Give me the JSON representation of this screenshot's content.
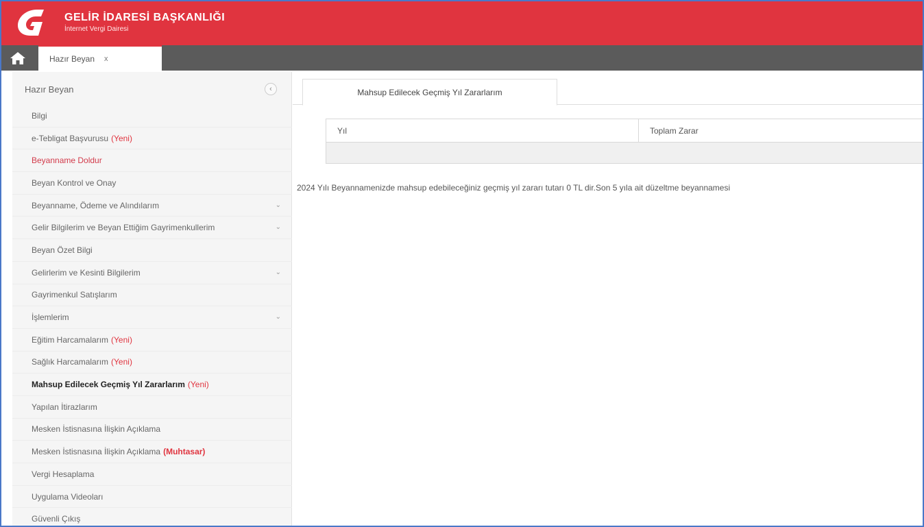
{
  "header": {
    "title": "GELİR İDARESİ BAŞKANLIĞI",
    "subtitle": "İnternet Vergi Dairesi",
    "bg_color": "#e0343f"
  },
  "tabbar": {
    "home_icon": "home-icon",
    "tabs": [
      {
        "label": "Hazır Beyan",
        "close": "x"
      }
    ]
  },
  "sidebar": {
    "title": "Hazır Beyan",
    "collapse_symbol": "‹",
    "items": [
      {
        "label": "Bilgi",
        "badge": "",
        "style": "normal",
        "chevron": ""
      },
      {
        "label": "e-Tebligat Başvurusu",
        "badge": "(Yeni)",
        "style": "normal",
        "chevron": ""
      },
      {
        "label": "Beyanname Doldur",
        "badge": "",
        "style": "red",
        "chevron": ""
      },
      {
        "label": "Beyan Kontrol ve Onay",
        "badge": "",
        "style": "normal",
        "chevron": ""
      },
      {
        "label": "Beyanname, Ödeme ve Alındılarım",
        "badge": "",
        "style": "normal",
        "chevron": "⌄"
      },
      {
        "label": "Gelir Bilgilerim ve Beyan Ettiğim Gayrimenkullerim",
        "badge": "",
        "style": "normal",
        "chevron": "⌄"
      },
      {
        "label": "Beyan Özet Bilgi",
        "badge": "",
        "style": "normal",
        "chevron": ""
      },
      {
        "label": "Gelirlerim ve Kesinti Bilgilerim",
        "badge": "",
        "style": "normal",
        "chevron": "⌄"
      },
      {
        "label": "Gayrimenkul Satışlarım",
        "badge": "",
        "style": "normal",
        "chevron": ""
      },
      {
        "label": "İşlemlerim",
        "badge": "",
        "style": "normal",
        "chevron": "⌄"
      },
      {
        "label": "Eğitim Harcamalarım",
        "badge": "(Yeni)",
        "style": "normal",
        "chevron": ""
      },
      {
        "label": "Sağlık Harcamalarım",
        "badge": "(Yeni)",
        "style": "normal",
        "chevron": ""
      },
      {
        "label": "Mahsup Edilecek Geçmiş Yıl Zararlarım",
        "badge": "(Yeni)",
        "style": "active",
        "chevron": ""
      },
      {
        "label": "Yapılan İtirazlarım",
        "badge": "",
        "style": "normal",
        "chevron": ""
      },
      {
        "label": "Mesken İstisnasına İlişkin Açıklama",
        "badge": "",
        "style": "normal",
        "chevron": ""
      },
      {
        "label": "Mesken İstisnasına İlişkin Açıklama",
        "badge": "(Muhtasar)",
        "style": "normal",
        "chevron": ""
      },
      {
        "label": "Vergi Hesaplama",
        "badge": "",
        "style": "normal",
        "chevron": ""
      },
      {
        "label": "Uygulama Videoları",
        "badge": "",
        "style": "normal",
        "chevron": ""
      },
      {
        "label": "Güvenli Çıkış",
        "badge": "",
        "style": "normal",
        "chevron": ""
      }
    ]
  },
  "main": {
    "tab_label": "Mahsup Edilecek Geçmiş Yıl Zararlarım",
    "table": {
      "columns": [
        "Yıl",
        "Toplam Zarar"
      ],
      "rows": []
    },
    "info_text": "2024 Yılı Beyannamenizde mahsup edebileceğiniz geçmiş yıl zararı tutarı 0 TL dir.Son 5 yıla ait düzeltme beyannamesi"
  },
  "colors": {
    "accent": "#e0343f",
    "tabbar": "#5b5b5b",
    "sidebar_bg": "#f5f5f5"
  }
}
